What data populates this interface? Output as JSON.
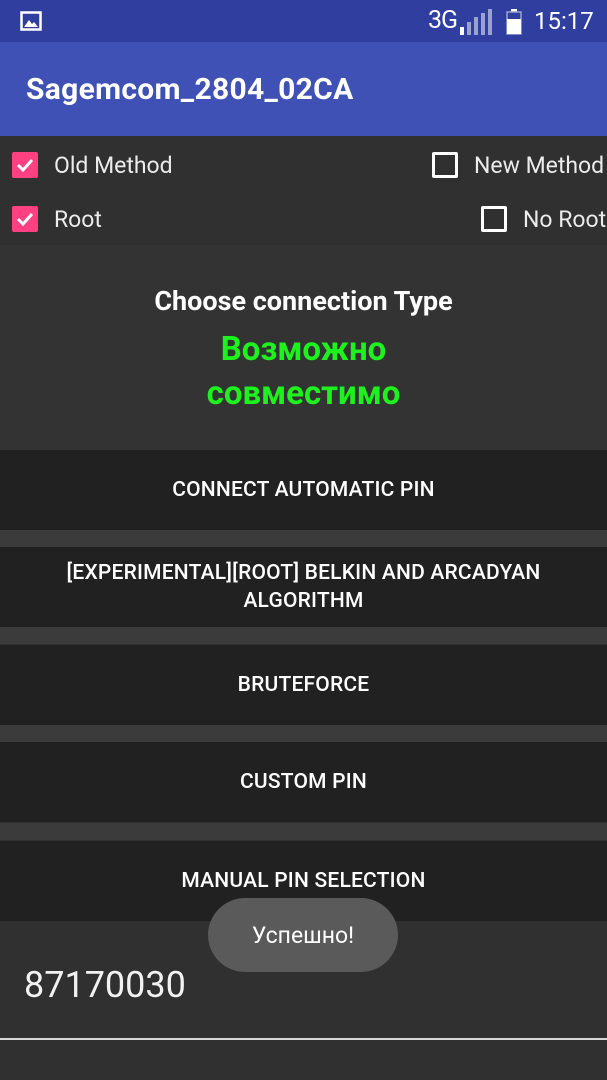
{
  "status_bar": {
    "network": "3G",
    "time": "15:17"
  },
  "app_bar": {
    "title": "Sagemcom_2804_02CA"
  },
  "options": {
    "old_method": {
      "label": "Old Method",
      "checked": true
    },
    "new_method": {
      "label": "New Method",
      "checked": false
    },
    "root": {
      "label": "Root",
      "checked": true
    },
    "no_root": {
      "label": "No Root",
      "checked": false
    }
  },
  "header": {
    "title": "Choose connection Type",
    "status_line1": "Возможно",
    "status_line2": "совместимо",
    "status_color": "#1EF21E"
  },
  "buttons": {
    "connect_automatic": "CONNECT AUTOMATIC PIN",
    "belkin_line1": "[EXPERIMENTAL][ROOT] BELKIN AND ARCADYAN",
    "belkin_line2": "ALGORITHM",
    "bruteforce": "BRUTEFORCE",
    "custom_pin": "CUSTOM PIN",
    "manual_pin": "MANUAL PIN SELECTION"
  },
  "pin": {
    "value": "87170030"
  },
  "toast": {
    "message": "Успешно!"
  },
  "colors": {
    "app_bar": "#3F51B5",
    "status_bar": "#303F9F",
    "accent": "#FF4081",
    "button_bg": "#212121",
    "background": "#303030"
  }
}
